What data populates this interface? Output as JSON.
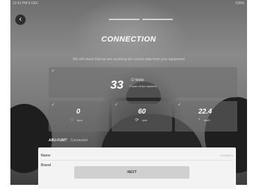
{
  "status_bar": {
    "left": "12:41 PM 8 DEC",
    "right": "100%"
  },
  "header": {
    "back_glyph": "‹",
    "title": "CONNECTION"
  },
  "subtitle": "We will check that we are receiving the correct data from your equipment",
  "power_card": {
    "value": "33",
    "unit": "Watts",
    "label": "Power of the machine",
    "icon": "power-icon"
  },
  "metrics": [
    {
      "name": "heart-rate",
      "value": "0",
      "unit": "bpm",
      "icon": "heart-icon"
    },
    {
      "name": "cadence",
      "value": "60",
      "unit": "rpm",
      "icon": "cadence-icon"
    },
    {
      "name": "speed",
      "value": "22.4",
      "unit": "km/h",
      "icon": "speed-icon"
    }
  ],
  "device": {
    "name": "ABU-FUMT",
    "status": "Connected"
  },
  "details": [
    {
      "label": "Name",
      "value": "KCUBER3"
    },
    {
      "label": "Brand",
      "value": ""
    }
  ],
  "next_label": "NEXT",
  "colors": {
    "panel": "#f3f3f3",
    "button": "#d0d0d0",
    "card": "#6e6e6e"
  }
}
